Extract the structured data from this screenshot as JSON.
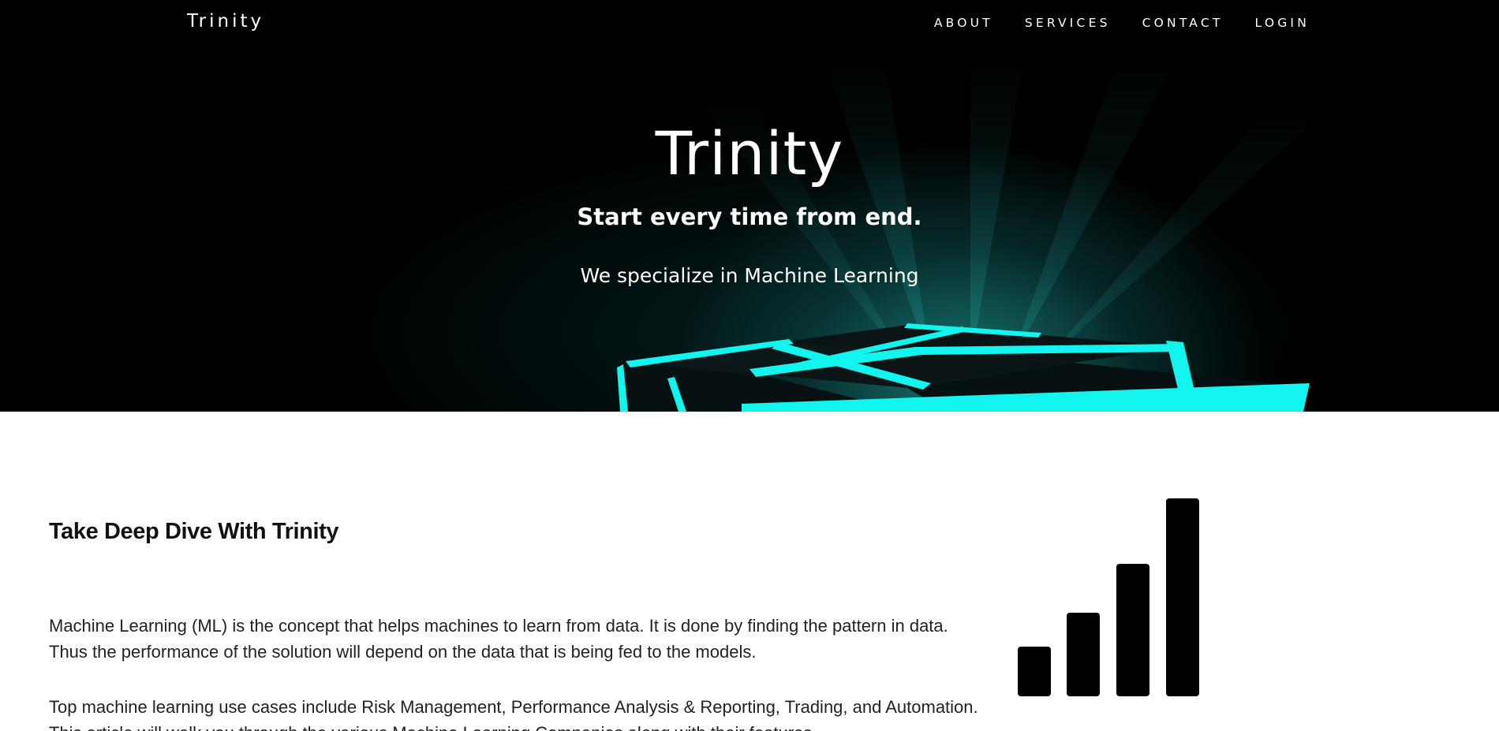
{
  "nav": {
    "brand": "Trinity",
    "links": [
      "ABOUT",
      "SERVICES",
      "CONTACT",
      "LOGIN"
    ]
  },
  "hero": {
    "title": "Trinity",
    "subtitle": "Start every time from end.",
    "tagline": "We specialize in Machine Learning"
  },
  "section": {
    "heading": "Take Deep Dive With Trinity",
    "paragraphs": [
      "Machine Learning (ML) is the concept that helps machines to learn from data. It is done by finding the pattern in data. Thus the performance of the solution will depend on the data that is being fed to the models.",
      "Top machine learning use cases include Risk Management, Performance Analysis & Reporting, Trading, and Automation. This article will walk you through the various Machine Learning Companies along with their features"
    ],
    "icon": "signal-bars-icon"
  },
  "colors": {
    "nav_bg": "#000000",
    "hero_glow": "#1de9e0",
    "text": "#222222"
  }
}
